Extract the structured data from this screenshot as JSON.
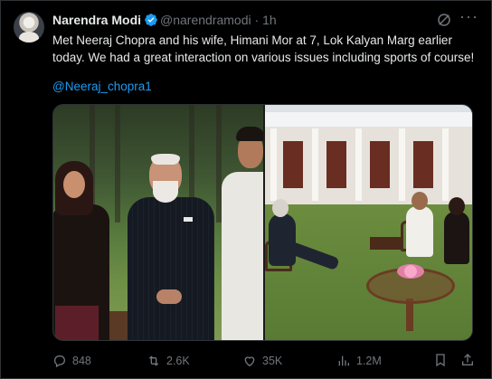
{
  "tweet": {
    "author_name": "Narendra Modi",
    "handle": "@narendramodi",
    "separator": "·",
    "time": "1h",
    "text": "Met Neeraj Chopra and his wife, Himani Mor at 7, Lok Kalyan Marg earlier today. We had a great interaction on various issues including sports of course!",
    "mention": "@Neeraj_chopra1",
    "verified_color": "#1d9bf0",
    "link_color": "#1d9bf0"
  },
  "icons": {
    "grok": "grok-icon",
    "more": "more-icon",
    "reply": "reply-icon",
    "retweet": "retweet-icon",
    "like": "like-icon",
    "views": "views-icon",
    "bookmark": "bookmark-icon",
    "share": "share-icon"
  },
  "actions": {
    "replies": "848",
    "retweets": "2.6K",
    "likes": "35K",
    "views": "1.2M"
  },
  "more_glyph": "···"
}
